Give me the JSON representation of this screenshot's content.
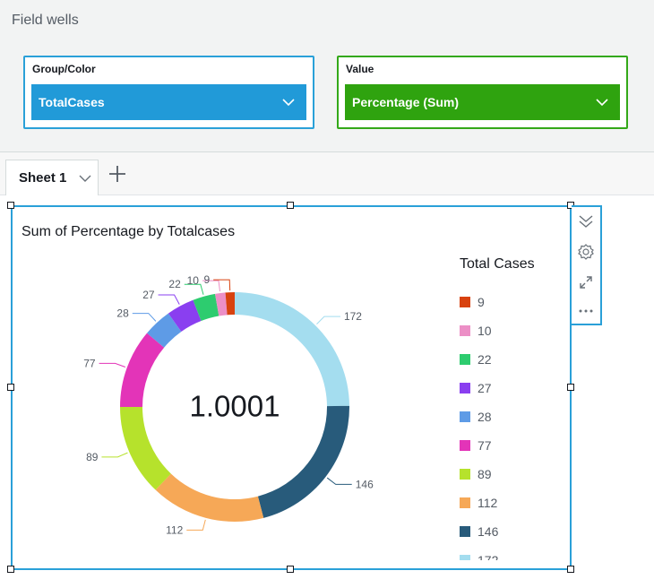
{
  "field_wells": {
    "title": "Field wells",
    "group_color": {
      "label": "Group/Color",
      "value": "TotalCases"
    },
    "value": {
      "label": "Value",
      "value": "Percentage (Sum)"
    }
  },
  "sheet_tab": {
    "label": "Sheet 1"
  },
  "visual": {
    "title": "Sum of Percentage by Totalcases",
    "center_value": "1.0001"
  },
  "legend": {
    "title": "Total Cases"
  },
  "chart_data": {
    "type": "pie",
    "title": "Sum of Percentage by Totalcases",
    "center_label": "1.0001",
    "categories": [
      "9",
      "10",
      "22",
      "27",
      "28",
      "77",
      "89",
      "112",
      "146",
      "172"
    ],
    "values": [
      9,
      10,
      22,
      27,
      28,
      77,
      89,
      112,
      146,
      172
    ],
    "colors": [
      "#d8420f",
      "#ec8fc6",
      "#2dcc6f",
      "#8a3ff0",
      "#5e9be6",
      "#e334b8",
      "#b6e22c",
      "#f6a857",
      "#285b7b",
      "#a4ddef"
    ],
    "legend_title": "Total Cases",
    "legend_position": "right"
  }
}
